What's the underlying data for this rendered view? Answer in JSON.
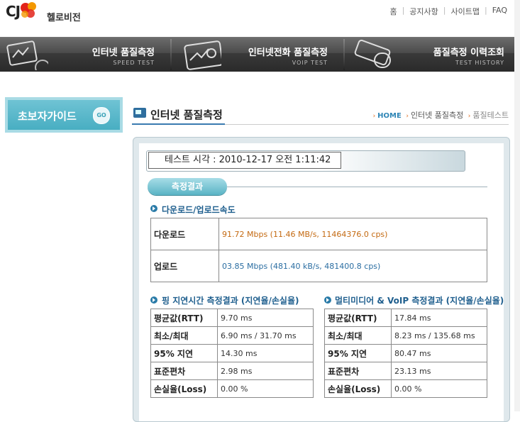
{
  "header": {
    "logo_cj": "CJ",
    "logo_text": "헬로비전",
    "topnav": [
      "홈",
      "공지사항",
      "사이트맵",
      "FAQ"
    ]
  },
  "nav": [
    {
      "title": "인터넷 품질측정",
      "sub": "SPEED TEST",
      "icon": "speed-test-icon"
    },
    {
      "title": "인터넷전화 품질측정",
      "sub": "VOIP TEST",
      "icon": "voip-test-icon"
    },
    {
      "title": "품질측정 이력조회",
      "sub": "TEST HISTORY",
      "icon": "test-history-icon"
    }
  ],
  "sidebar": {
    "guide_label": "초보자가이드",
    "go_label": "GO"
  },
  "page": {
    "title": "인터넷 품질측정",
    "breadcrumb": {
      "home": "HOME",
      "parent": "인터넷 품질측정",
      "current": "품질테스트"
    }
  },
  "test_time": "테스트 시각 : 2010-12-17 오전 1:11:42",
  "result_button": "측정결과",
  "speed": {
    "section_title": "다운로드/업로드속도",
    "rows": [
      {
        "label": "다운로드",
        "value": "91.72 Mbps (11.46 MB/s, 11464376.0 cps)"
      },
      {
        "label": "업로드",
        "value": "03.85 Mbps (481.40 kB/s, 481400.8 cps)"
      }
    ]
  },
  "ping": {
    "section_title": "핑 지연시간 측정결과 (지연율/손실율)",
    "rows": [
      {
        "label": "평균값(RTT)",
        "value": "9.70 ms"
      },
      {
        "label": "최소/최대",
        "value": "6.90 ms / 31.70 ms"
      },
      {
        "label": "95% 지연",
        "value": "14.30 ms"
      },
      {
        "label": "표준편차",
        "value": "2.98 ms"
      },
      {
        "label": "손실율(Loss)",
        "value": "0.00 %"
      }
    ]
  },
  "voip": {
    "section_title": "멀티미디어 & VoIP 측정결과 (지연율/손실율)",
    "rows": [
      {
        "label": "평균값(RTT)",
        "value": "17.84 ms"
      },
      {
        "label": "최소/최대",
        "value": "8.23 ms / 135.68 ms"
      },
      {
        "label": "95% 지연",
        "value": "80.47 ms"
      },
      {
        "label": "표준편차",
        "value": "23.13 ms"
      },
      {
        "label": "손실율(Loss)",
        "value": "0.00 %"
      }
    ]
  },
  "colors": {
    "accent": "#3a7bb0",
    "download": "#c46a12",
    "upload": "#2b6ea2",
    "guide": "#48aec2"
  }
}
